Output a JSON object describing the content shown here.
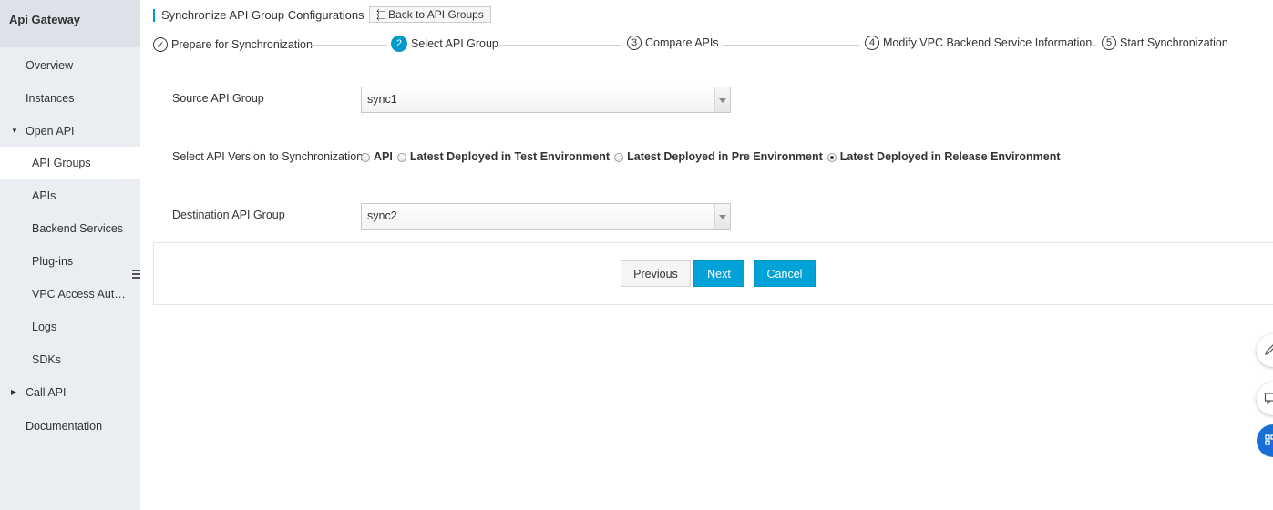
{
  "sidebar": {
    "title": "Api Gateway",
    "items": [
      {
        "label": "Overview"
      },
      {
        "label": "Instances"
      },
      {
        "label": "Open API"
      },
      {
        "label": "API Groups"
      },
      {
        "label": "APIs"
      },
      {
        "label": "Backend Services"
      },
      {
        "label": "Plug-ins"
      },
      {
        "label": "VPC Access Authorizations"
      },
      {
        "label": "Logs"
      },
      {
        "label": "SDKs"
      },
      {
        "label": "Call API"
      },
      {
        "label": "Documentation"
      }
    ]
  },
  "header": {
    "title": "Synchronize API Group Configurations",
    "back_label": "Back to API Groups"
  },
  "steps": [
    {
      "num": "1",
      "label": "Prepare for Synchronization",
      "state": "done"
    },
    {
      "num": "2",
      "label": "Select API Group",
      "state": "current"
    },
    {
      "num": "3",
      "label": "Compare APIs",
      "state": "pending"
    },
    {
      "num": "4",
      "label": "Modify VPC Backend Service Information",
      "state": "pending"
    },
    {
      "num": "5",
      "label": "Start Synchronization",
      "state": "pending"
    }
  ],
  "form": {
    "source_label": "Source API Group",
    "source_value": "sync1",
    "version_label": "Select API Version to Synchronization",
    "version_options": [
      {
        "label": "API",
        "checked": false
      },
      {
        "label": "Latest Deployed in Test Environment",
        "checked": false
      },
      {
        "label": "Latest Deployed in Pre Environment",
        "checked": false
      },
      {
        "label": "Latest Deployed in Release Environment",
        "checked": true
      }
    ],
    "destination_label": "Destination API Group",
    "destination_value": "sync2"
  },
  "actions": {
    "previous_label": "Previous",
    "next_label": "Next",
    "cancel_label": "Cancel"
  },
  "colors": {
    "accent": "#00a2d8",
    "sidebar_bg": "#eaedf1"
  }
}
